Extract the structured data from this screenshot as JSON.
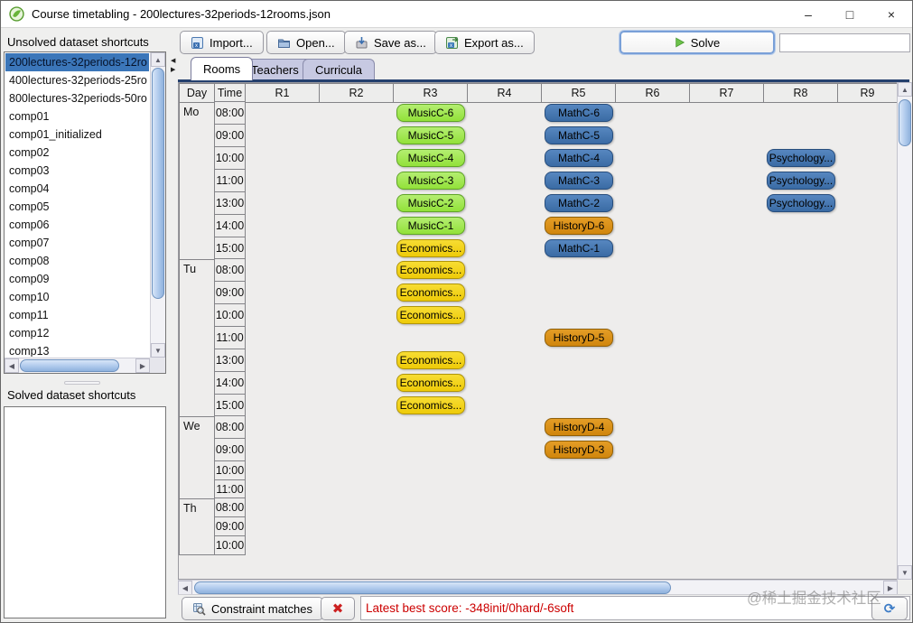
{
  "window": {
    "title": "Course timetabling - 200lectures-32periods-12rooms.json",
    "minimize": "–",
    "maximize": "□",
    "close": "×"
  },
  "unsolved_panel": {
    "label": "Unsolved dataset shortcuts",
    "selected_index": 0,
    "items": [
      "200lectures-32periods-12ro",
      "400lectures-32periods-25ro",
      "800lectures-32periods-50ro",
      "comp01",
      "comp01_initialized",
      "comp02",
      "comp03",
      "comp04",
      "comp05",
      "comp06",
      "comp07",
      "comp08",
      "comp09",
      "comp10",
      "comp11",
      "comp12",
      "comp13"
    ]
  },
  "solved_panel": {
    "label": "Solved dataset shortcuts",
    "items": []
  },
  "toolbar": {
    "import": "Import...",
    "open": "Open...",
    "save_as": "Save as...",
    "export_as": "Export as...",
    "solve": "Solve"
  },
  "tabs": [
    {
      "label": "Rooms",
      "selected": true
    },
    {
      "label": "Teachers",
      "selected": false
    },
    {
      "label": "Curricula",
      "selected": false
    }
  ],
  "grid": {
    "columns": [
      "Day",
      "Time",
      "R1",
      "R2",
      "R3",
      "R4",
      "R5",
      "R6",
      "R7",
      "R8",
      "R9"
    ],
    "day_groups": [
      {
        "day": "Mo",
        "rows": [
          {
            "time": "08:00",
            "lectures": [
              {
                "room": "R3",
                "label": "MusicC-6",
                "color": "green"
              },
              {
                "room": "R5",
                "label": "MathC-6",
                "color": "blue"
              }
            ]
          },
          {
            "time": "09:00",
            "lectures": [
              {
                "room": "R3",
                "label": "MusicC-5",
                "color": "green"
              },
              {
                "room": "R5",
                "label": "MathC-5",
                "color": "blue"
              }
            ]
          },
          {
            "time": "10:00",
            "lectures": [
              {
                "room": "R3",
                "label": "MusicC-4",
                "color": "green"
              },
              {
                "room": "R5",
                "label": "MathC-4",
                "color": "blue"
              },
              {
                "room": "R8",
                "label": "Psychology...",
                "color": "blue"
              }
            ]
          },
          {
            "time": "11:00",
            "lectures": [
              {
                "room": "R3",
                "label": "MusicC-3",
                "color": "green"
              },
              {
                "room": "R5",
                "label": "MathC-3",
                "color": "blue"
              },
              {
                "room": "R8",
                "label": "Psychology...",
                "color": "blue"
              }
            ]
          },
          {
            "time": "13:00",
            "lectures": [
              {
                "room": "R3",
                "label": "MusicC-2",
                "color": "green"
              },
              {
                "room": "R5",
                "label": "MathC-2",
                "color": "blue"
              },
              {
                "room": "R8",
                "label": "Psychology...",
                "color": "blue"
              }
            ]
          },
          {
            "time": "14:00",
            "lectures": [
              {
                "room": "R3",
                "label": "MusicC-1",
                "color": "green"
              },
              {
                "room": "R5",
                "label": "HistoryD-6",
                "color": "orange"
              }
            ]
          },
          {
            "time": "15:00",
            "lectures": [
              {
                "room": "R3",
                "label": "Economics...",
                "color": "yellow"
              },
              {
                "room": "R5",
                "label": "MathC-1",
                "color": "blue"
              }
            ]
          }
        ]
      },
      {
        "day": "Tu",
        "rows": [
          {
            "time": "08:00",
            "lectures": [
              {
                "room": "R3",
                "label": "Economics...",
                "color": "yellow"
              }
            ]
          },
          {
            "time": "09:00",
            "lectures": [
              {
                "room": "R3",
                "label": "Economics...",
                "color": "yellow"
              }
            ]
          },
          {
            "time": "10:00",
            "lectures": [
              {
                "room": "R3",
                "label": "Economics...",
                "color": "yellow"
              }
            ]
          },
          {
            "time": "11:00",
            "lectures": [
              {
                "room": "R5",
                "label": "HistoryD-5",
                "color": "orange"
              }
            ]
          },
          {
            "time": "13:00",
            "lectures": [
              {
                "room": "R3",
                "label": "Economics...",
                "color": "yellow"
              }
            ]
          },
          {
            "time": "14:00",
            "lectures": [
              {
                "room": "R3",
                "label": "Economics...",
                "color": "yellow"
              }
            ]
          },
          {
            "time": "15:00",
            "lectures": [
              {
                "room": "R3",
                "label": "Economics...",
                "color": "yellow"
              }
            ]
          }
        ]
      },
      {
        "day": "We",
        "rows": [
          {
            "time": "08:00",
            "lectures": [
              {
                "room": "R5",
                "label": "HistoryD-4",
                "color": "orange"
              }
            ]
          },
          {
            "time": "09:00",
            "lectures": [
              {
                "room": "R5",
                "label": "HistoryD-3",
                "color": "orange"
              }
            ]
          },
          {
            "time": "10:00",
            "lectures": []
          },
          {
            "time": "11:00",
            "lectures": []
          }
        ]
      },
      {
        "day": "Th",
        "rows": [
          {
            "time": "08:00",
            "lectures": []
          },
          {
            "time": "09:00",
            "lectures": []
          },
          {
            "time": "10:00",
            "lectures": []
          }
        ]
      }
    ]
  },
  "statusbar": {
    "constraint_matches": "Constraint matches",
    "delete_glyph": "✖",
    "score": "Latest best score: -348init/0hard/-6soft",
    "refresh_glyph": "⟳"
  },
  "watermark": "@稀土掘金技术社区",
  "colors": {
    "chip_green": "#9ce24c",
    "chip_blue": "#4478b5",
    "chip_yellow": "#f2d018",
    "chip_orange": "#de9014",
    "selection": "#3b76b9",
    "score_text": "#cc0000",
    "tab_underline": "#24406e"
  }
}
